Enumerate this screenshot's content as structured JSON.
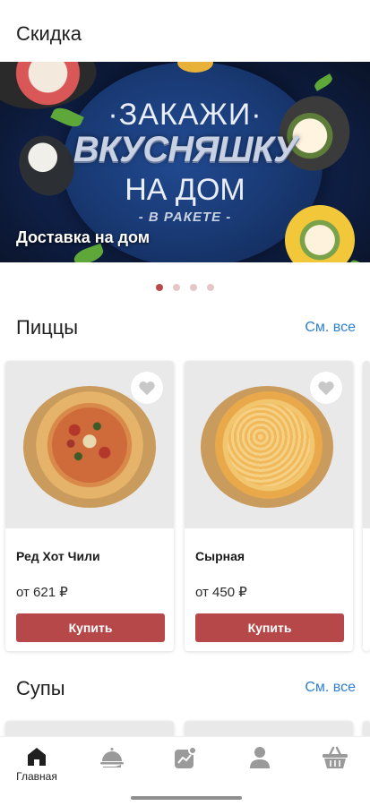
{
  "discount": {
    "title": "Скидка"
  },
  "banner": {
    "line1": "·ЗАКАЖИ·",
    "line2": "ВКУСНЯШКУ",
    "line3": "НА ДОМ",
    "line4": "- В РАКЕТЕ -",
    "caption": "Доставка на дом",
    "slides": 4,
    "active_slide": 1
  },
  "pizzas": {
    "title": "Пиццы",
    "see_all": "См. все",
    "items": [
      {
        "name": "Ред Хот Чили",
        "price": "от 621 ₽",
        "buy_label": "Купить",
        "favorite": false
      },
      {
        "name": "Сырная",
        "price": "от 450 ₽",
        "buy_label": "Купить",
        "favorite": false
      }
    ]
  },
  "soups": {
    "title": "Супы",
    "see_all": "См. все"
  },
  "nav": {
    "items": [
      {
        "icon": "home-icon",
        "label": "Главная",
        "active": true
      },
      {
        "icon": "dish-icon",
        "label": ""
      },
      {
        "icon": "promo-icon",
        "label": ""
      },
      {
        "icon": "profile-icon",
        "label": ""
      },
      {
        "icon": "basket-icon",
        "label": ""
      }
    ]
  },
  "colors": {
    "accent": "#b7484a",
    "link": "#2d7fd3",
    "dot_active": "#b84a4a",
    "dot_inactive": "#e6c7c7"
  }
}
